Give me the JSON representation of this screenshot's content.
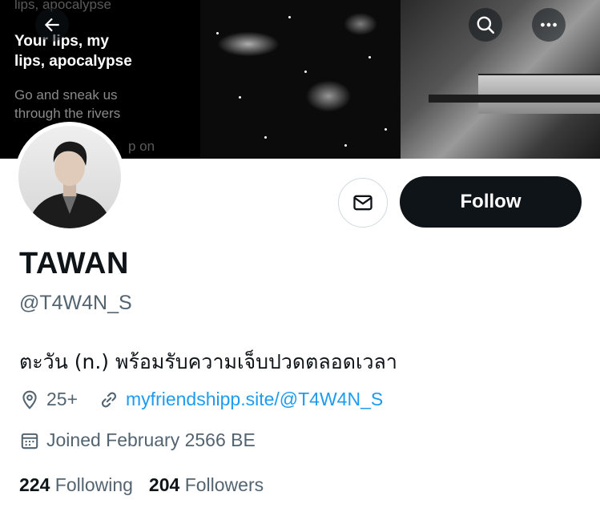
{
  "header": {
    "back_icon": "arrow-left-icon",
    "search_icon": "search-icon",
    "more_icon": "more-horizontal-icon"
  },
  "banner": {
    "lyrics_line1": "Your lips, my",
    "lyrics_line2": "lips, apocalypse",
    "lyrics_line3": "Go and sneak us",
    "lyrics_line4": "through the rivers",
    "lyrics_faint_top": "lips, apocalypse",
    "lyrics_faint_bottom": "p on"
  },
  "profile": {
    "name": "TAWAN",
    "handle": "@T4W4N_S",
    "bio": "ตะวัน (n.) พร้อมรับความเจ็บปวดตลอดเวลา",
    "location": "25+",
    "website": "myfriendshipp.site/@T4W4N_S",
    "joined": "Joined February 2566 BE"
  },
  "actions": {
    "message_icon": "envelope-icon",
    "follow_label": "Follow"
  },
  "stats": {
    "following_count": "224",
    "following_label": "Following",
    "followers_count": "204",
    "followers_label": "Followers"
  },
  "colors": {
    "text_primary": "#0f1419",
    "text_secondary": "#536471",
    "link": "#1d9bf0",
    "button_dark": "#0f1419"
  }
}
